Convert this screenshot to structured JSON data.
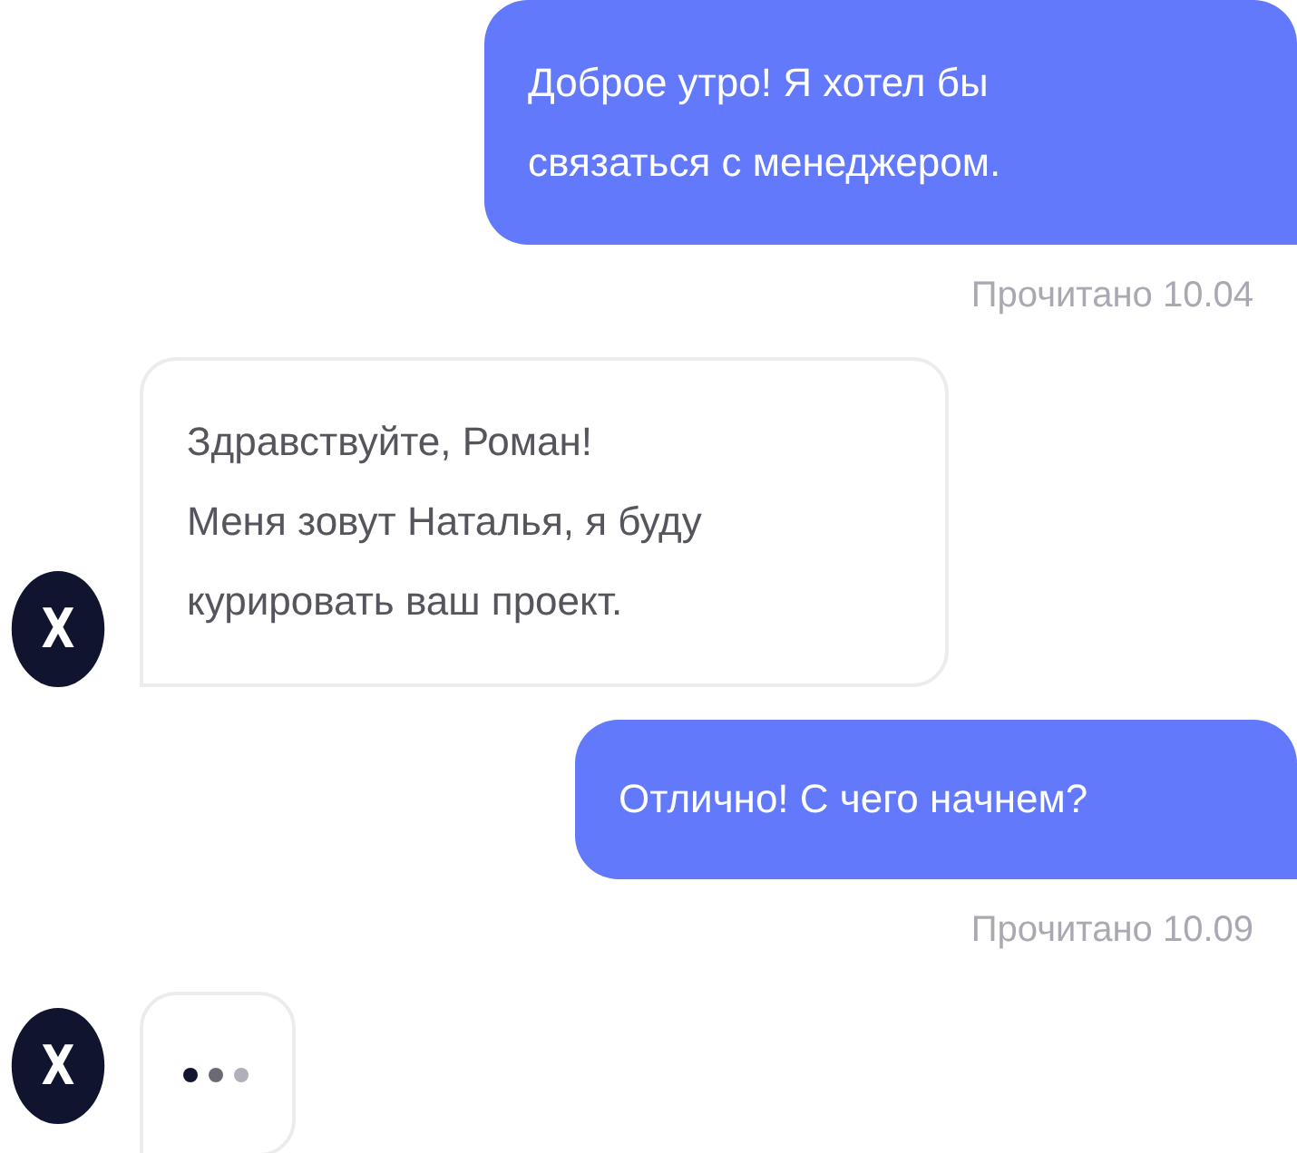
{
  "messages": [
    {
      "kind": "outgoing",
      "text": "Доброе утро! Я хотел бы\nсвязаться с менеджером.",
      "status": "Прочитано 10.04"
    },
    {
      "kind": "incoming",
      "avatar": "X",
      "text": "Здравствуйте, Роман!\nМеня зовут Наталья, я буду\nкурировать ваш проект."
    },
    {
      "kind": "outgoing",
      "text": "Отлично! С чего начнем?",
      "status": "Прочитано 10.09"
    },
    {
      "kind": "typing",
      "avatar": "X"
    }
  ]
}
